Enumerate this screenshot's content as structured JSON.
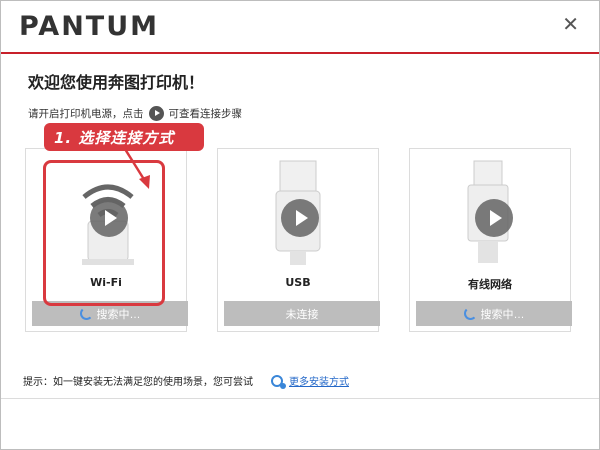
{
  "app": {
    "logo": "PANTUM",
    "close": "✕"
  },
  "welcome": "欢迎您使用奔图打印机！",
  "hint": {
    "before": "请开启打印机电源，点击",
    "after": "可查看连接步骤"
  },
  "callout": "1. 选择连接方式",
  "cards": [
    {
      "label": "Wi-Fi",
      "status": "搜索中…"
    },
    {
      "label": "USB",
      "status": "未连接"
    },
    {
      "label": "有线网络",
      "status": "搜索中…"
    }
  ],
  "footer": {
    "tip": "提示：如一键安装无法满足您的使用场景，您可尝试",
    "link": "更多安装方式"
  },
  "colors": {
    "accent": "#c8202a",
    "callout": "#d9393f",
    "link": "#2468c8",
    "button": "#bdbdbd"
  }
}
